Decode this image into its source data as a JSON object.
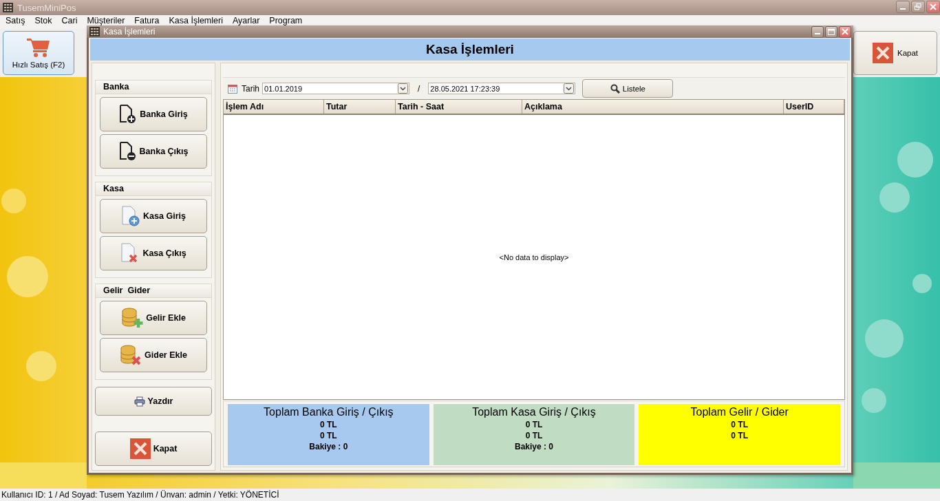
{
  "app_window": {
    "title": "TusemMiniPos"
  },
  "menu": [
    "Satış",
    "Stok",
    "Cari",
    "Müşteriler",
    "Fatura",
    "Kasa İşlemleri",
    "Ayarlar",
    "Program"
  ],
  "toolbar": [
    {
      "label": "Hızlı Satış (F2)",
      "kind": "cart",
      "selected": true
    },
    {
      "label": "Kapat",
      "kind": "close",
      "selected": false
    }
  ],
  "dialog": {
    "title": "Kasa İşlemleri",
    "header": "Kasa İşlemleri",
    "groups": [
      {
        "title": "Banka",
        "buttons": [
          {
            "label": "Banka Giriş",
            "kind": "doc-plus"
          },
          {
            "label": "Banka Çıkış",
            "kind": "doc-minus"
          }
        ]
      },
      {
        "title": "Kasa",
        "buttons": [
          {
            "label": "Kasa Giriş",
            "kind": "file-plus"
          },
          {
            "label": "Kasa Çıkış",
            "kind": "file-x"
          }
        ]
      },
      {
        "title": "Gelir  Gider",
        "buttons": [
          {
            "label": "Gelir Ekle",
            "kind": "db-plus"
          },
          {
            "label": "Gider Ekle",
            "kind": "db-x"
          }
        ]
      }
    ],
    "extra_buttons": [
      {
        "label": "Yazdır",
        "kind": "printer"
      },
      {
        "label": "Kapat",
        "kind": "close"
      }
    ],
    "filter": {
      "label": "Tarih",
      "start": "01.01.2019",
      "separator": "/",
      "end": "28.05.2021 17:23:39",
      "button": "Listele"
    },
    "table": {
      "columns": [
        "İşlem Adı",
        "Tutar",
        "Tarih - Saat",
        "Açıklama",
        "UserID"
      ],
      "empty_text": "<No data to display>"
    },
    "summaries": [
      {
        "title": "Toplam Banka Giriş / Çıkış",
        "color": "#a7c9ef",
        "lines": [
          "0 TL",
          "0 TL",
          "Bakiye : 0"
        ]
      },
      {
        "title": "Toplam Kasa Giriş / Çıkış",
        "color": "#c0dcc2",
        "lines": [
          "0 TL",
          "0 TL",
          "Bakiye : 0"
        ]
      },
      {
        "title": "Toplam Gelir / Gider",
        "color": "#ffff00",
        "lines": [
          "0 TL",
          "0 TL"
        ]
      }
    ]
  },
  "status_bar": "Kullanıcı ID: 1 / Ad Soyad: Tusem Yazılım / Ünvan: admin / Yetki: YÖNETİCİ"
}
